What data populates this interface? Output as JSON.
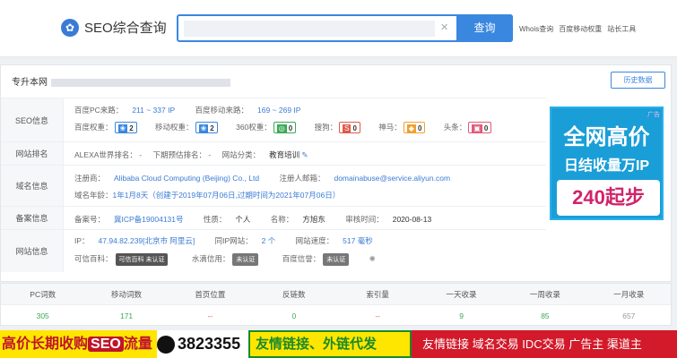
{
  "header": {
    "logo_text": "SEO综合查询",
    "search_button": "查询",
    "search_placeholder": "",
    "links": [
      "Whois查询",
      "百度移动权重",
      "站长工具"
    ]
  },
  "site": {
    "title_prefix": "专升本网",
    "history_button": "历史数据"
  },
  "rows": {
    "seo": {
      "label": "SEO信息",
      "pc_label": "百度PC来路：",
      "pc_value": "211 ~ 337 IP",
      "mobile_label": "百度移动来路：",
      "mobile_value": "169 ~ 269 IP",
      "baidu_weight_label": "百度权重：",
      "baidu_weight": "2",
      "mobile_weight_label": "移动权重：",
      "mobile_weight": "2",
      "weight360_label": "360权重：",
      "weight360": "0",
      "sogou_label": "搜狗：",
      "sogou": "0",
      "shenma_label": "神马：",
      "shenma": "0",
      "toutiao_label": "头条：",
      "toutiao": "0"
    },
    "rank": {
      "label": "网站排名",
      "alexa": "ALEXA世界排名： -",
      "forecast": "下期预估排名： -",
      "category_label": "网站分类：",
      "category": "教育培训"
    },
    "domain": {
      "label": "域名信息",
      "registrar_label": "注册商：",
      "registrar": "Alibaba Cloud Computing (Beijing) Co., Ltd",
      "email_label": "注册人邮箱：",
      "email": "domainabuse@service.aliyun.com",
      "age_label": "域名年龄：",
      "age": "1年1月8天（创建于2019年07月06日,过期时间为2021年07月06日）"
    },
    "icp": {
      "label": "备案信息",
      "no_label": "备案号：",
      "no": "冀ICP备19004131号",
      "nature_label": "性质：",
      "nature": "个人",
      "name_label": "名称：",
      "name": "方旭东",
      "time_label": "审核时间：",
      "time": "2020-08-13"
    },
    "web": {
      "label": "网站信息",
      "ip_label": "IP：",
      "ip": "47.94.82.239[北京市 阿里云]",
      "same_ip_label": "同IP网站：",
      "same_ip": "2 个",
      "speed_label": "网站速度：",
      "speed": "517 毫秒",
      "trust_label": "可信百科：",
      "trust_badge": "可信百科 未认证",
      "water_label": "水滴信用：",
      "water_badge": "未认证",
      "baidu_trust_label": "百度信誉：",
      "baidu_trust_badge": "未认证"
    }
  },
  "ad": {
    "tag": "广告",
    "line1": "全网高价",
    "line2": "日结收量万IP",
    "line3": "240起步"
  },
  "stats": {
    "headers": [
      "PC词数",
      "移动词数",
      "首页位置",
      "反链数",
      "索引量",
      "一天收录",
      "一周收录",
      "一月收录"
    ],
    "values": [
      "305",
      "171",
      "--",
      "0",
      "--",
      "9",
      "85",
      "657"
    ]
  },
  "banners": {
    "b1_text": "高价长期收购",
    "b1_seo": "SEO",
    "b1_tail": "流量",
    "b2_text": "3823355",
    "b3_text": "友情链接、外链代发",
    "b4_text": "友情链接  域名交易  IDC交易  广告主  渠道主"
  },
  "colors": {
    "accent": "#3a87e0",
    "green": "#3aaa55",
    "red": "#e05a4a"
  }
}
